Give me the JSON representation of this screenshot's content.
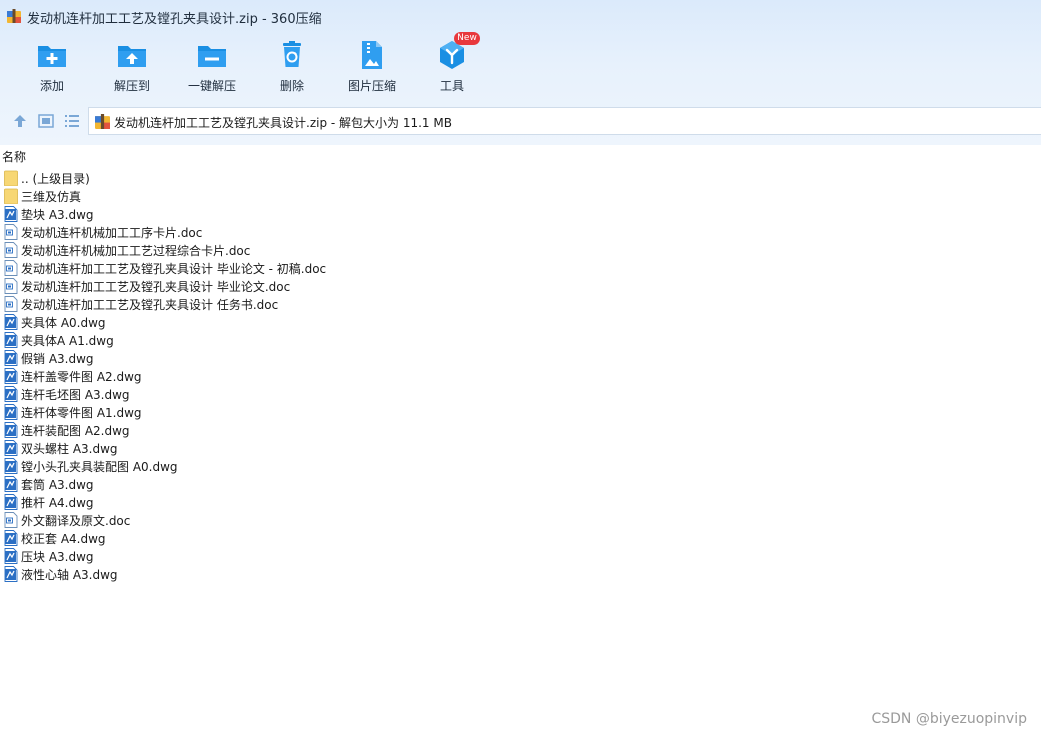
{
  "window": {
    "title": "发动机连杆加工工艺及镗孔夹具设计.zip - 360压缩"
  },
  "toolbar": {
    "buttons": [
      {
        "label": "添加",
        "icon": "add-folder-icon"
      },
      {
        "label": "解压到",
        "icon": "extract-to-folder-icon"
      },
      {
        "label": "一键解压",
        "icon": "one-click-extract-icon"
      },
      {
        "label": "删除",
        "icon": "recycle-bin-icon"
      },
      {
        "label": "图片压缩",
        "icon": "image-compress-icon"
      },
      {
        "label": "工具",
        "icon": "tools-cube-icon",
        "badge": "New"
      }
    ]
  },
  "address": {
    "text": "发动机连杆加工工艺及镗孔夹具设计.zip - 解包大小为 11.1 MB"
  },
  "columns": {
    "name": "名称"
  },
  "files": [
    {
      "name": ".. (上级目录)",
      "type": "folder"
    },
    {
      "name": "三维及仿真",
      "type": "folder"
    },
    {
      "name": "垫块 A3.dwg",
      "type": "dwg"
    },
    {
      "name": "发动机连杆机械加工工序卡片.doc",
      "type": "doc"
    },
    {
      "name": "发动机连杆机械加工工艺过程综合卡片.doc",
      "type": "doc"
    },
    {
      "name": "发动机连杆加工工艺及镗孔夹具设计 毕业论文 - 初稿.doc",
      "type": "doc"
    },
    {
      "name": "发动机连杆加工工艺及镗孔夹具设计 毕业论文.doc",
      "type": "doc"
    },
    {
      "name": "发动机连杆加工工艺及镗孔夹具设计 任务书.doc",
      "type": "doc"
    },
    {
      "name": "夹具体 A0.dwg",
      "type": "dwg"
    },
    {
      "name": "夹具体A A1.dwg",
      "type": "dwg"
    },
    {
      "name": "假销 A3.dwg",
      "type": "dwg"
    },
    {
      "name": "连杆盖零件图 A2.dwg",
      "type": "dwg"
    },
    {
      "name": "连杆毛坯图 A3.dwg",
      "type": "dwg"
    },
    {
      "name": "连杆体零件图 A1.dwg",
      "type": "dwg"
    },
    {
      "name": "连杆装配图 A2.dwg",
      "type": "dwg"
    },
    {
      "name": "双头螺柱 A3.dwg",
      "type": "dwg"
    },
    {
      "name": "镗小头孔夹具装配图 A0.dwg",
      "type": "dwg"
    },
    {
      "name": "套筒 A3.dwg",
      "type": "dwg"
    },
    {
      "name": "推杆 A4.dwg",
      "type": "dwg"
    },
    {
      "name": "外文翻译及原文.doc",
      "type": "doc"
    },
    {
      "name": "校正套 A4.dwg",
      "type": "dwg"
    },
    {
      "name": "压块 A3.dwg",
      "type": "dwg"
    },
    {
      "name": "液性心轴 A3.dwg",
      "type": "dwg"
    }
  ],
  "watermark": "CSDN @biyezuopinvip",
  "colors": {
    "accent": "#1a8fe3",
    "folder": "#f7d774",
    "badge": "#e8383d"
  }
}
